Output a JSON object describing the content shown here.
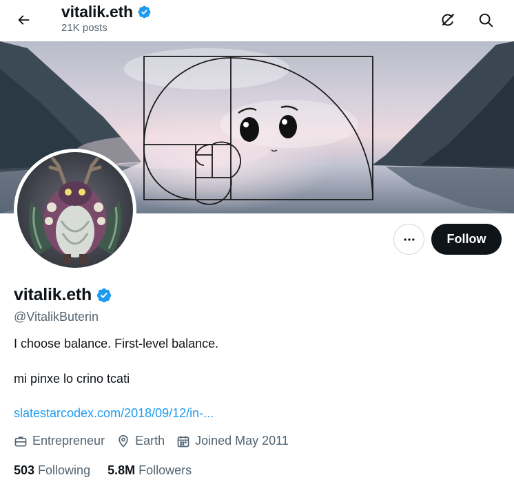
{
  "header": {
    "name": "vitalik.eth",
    "posts": "21K posts",
    "back_icon": "arrow-left-icon",
    "grok_icon": "grok-icon",
    "search_icon": "search-icon"
  },
  "profile": {
    "name": "vitalik.eth",
    "handle": "@VitalikButerin",
    "bio_line1": "I choose balance. First-level balance.",
    "bio_line2": "mi pinxe lo crino tcati",
    "link": "slatestarcodex.com/2018/09/12/in-...",
    "profession": "Entrepreneur",
    "location": "Earth",
    "joined": "Joined May 2011",
    "following_count": "503",
    "following_label": "Following",
    "followers_count": "5.8M",
    "followers_label": "Followers"
  },
  "actions": {
    "follow_label": "Follow",
    "more_icon": "more-icon"
  },
  "colors": {
    "accent": "#1d9bf0",
    "text": "#0f1419",
    "muted": "#536471",
    "button_dark": "#0f1419"
  }
}
